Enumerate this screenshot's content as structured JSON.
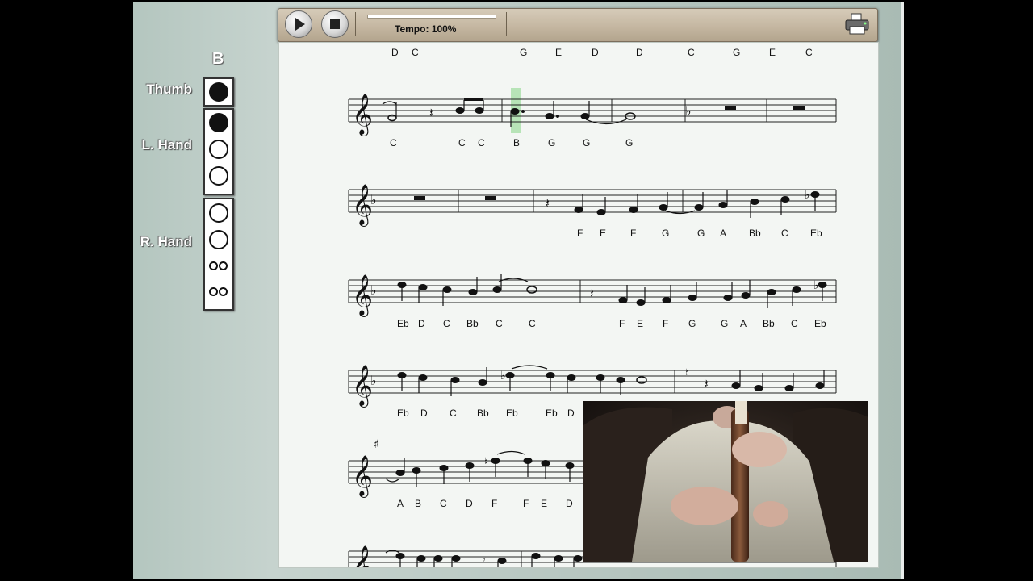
{
  "current_note": "B",
  "fingering": {
    "thumb_label": "Thumb",
    "left_hand_label": "L. Hand",
    "right_hand_label": "R. Hand"
  },
  "toolbar": {
    "play_icon": "play-icon",
    "stop_icon": "stop-icon",
    "tempo_label": "Tempo: 100%",
    "print_icon": "printer-icon"
  },
  "score": {
    "header_notes": [
      "D",
      "C",
      "G",
      "E",
      "D",
      "D",
      "C",
      "G",
      "E",
      "C"
    ],
    "row1_notes": [
      "C",
      "C",
      "C",
      "B",
      "G",
      "G",
      "G"
    ],
    "row2_notes": [
      "F",
      "E",
      "F",
      "G",
      "G",
      "A",
      "Bb",
      "C",
      "Eb"
    ],
    "row3_notes": [
      "Eb",
      "D",
      "C",
      "Bb",
      "C",
      "C",
      "F",
      "E",
      "F",
      "G",
      "G",
      "A",
      "Bb",
      "C",
      "Eb"
    ],
    "row4_notes": [
      "Eb",
      "D",
      "C",
      "Bb",
      "Eb",
      "Eb",
      "D"
    ],
    "row5_notes": [
      "A",
      "B",
      "C",
      "D",
      "F",
      "F",
      "E",
      "D"
    ]
  },
  "colors": {
    "highlight": "#a8e0a8",
    "toolbar": "#c9bda9",
    "panel": "#bccbc5"
  }
}
